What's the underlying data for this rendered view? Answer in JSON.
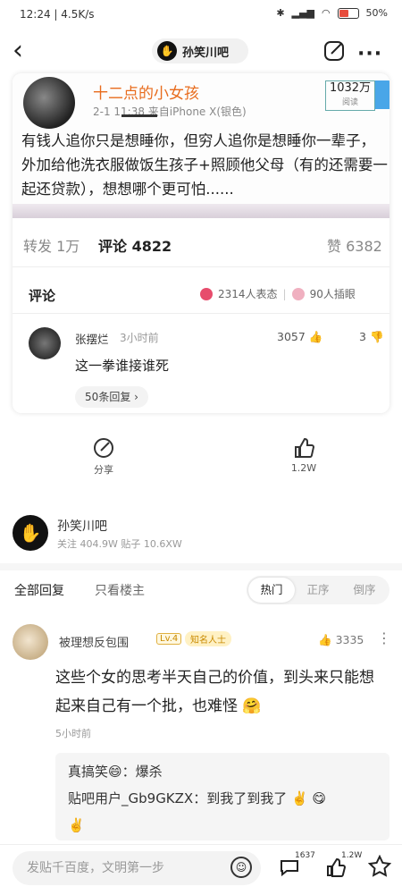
{
  "status": {
    "time_speed": "12:24 | 4.5K/s",
    "battery": "50%"
  },
  "nav": {
    "back": "‹",
    "forum": "孙笑川吧",
    "forum_avatar": "✋",
    "more": "···"
  },
  "weibo": {
    "name": "十二点的小女孩",
    "time": "2-1 11:38  来自iPhone X(银色)",
    "reads": "1032万",
    "reads_label": "阅读",
    "text": "有钱人追你只是想睡你，但穷人追你是想睡你一辈子，外加给他洗衣服做饭生孩子+照顾他父母（有的还需要一起还贷款），想想哪个更可怕......"
  },
  "stats": {
    "repost": "转发 1万",
    "comments": "评论 4822",
    "likes": "赞 6382"
  },
  "comment_section": {
    "title": "评论",
    "reactions": "2314人表态",
    "inserted": "90人插眼",
    "comment": {
      "user": "张摆烂",
      "time": "3小时前",
      "likes": "3057",
      "dislikes": "3",
      "body": "这一拳谁接谁死",
      "replies": "50条回复 ›"
    }
  },
  "actions": {
    "share": "分享",
    "like": "1.2W"
  },
  "forum_row": {
    "name": "孙笑川吧",
    "stats": "关注 404.9W  贴子 10.6XW"
  },
  "tabs": {
    "all": "全部回复",
    "host": "只看楼主",
    "sort": [
      "热门",
      "正序",
      "倒序"
    ]
  },
  "post": {
    "user": "被理想反包围",
    "level": "Lv.4",
    "badge": "知名人士",
    "likes": "3335",
    "body": "这些个女的思考半天自己的价值，到头来只能想起来自己有一个批，也难怪 🤗",
    "time": "5小时前",
    "sub_replies": [
      "真搞笑😄：爆杀",
      "贴吧用户_Gb9GKZX：到我了到我了 ✌️ 😋",
      "✌️"
    ]
  },
  "bottom": {
    "placeholder": "发贴千百度，文明第一步",
    "comment_count": "1637",
    "like_count": "1.2W"
  }
}
